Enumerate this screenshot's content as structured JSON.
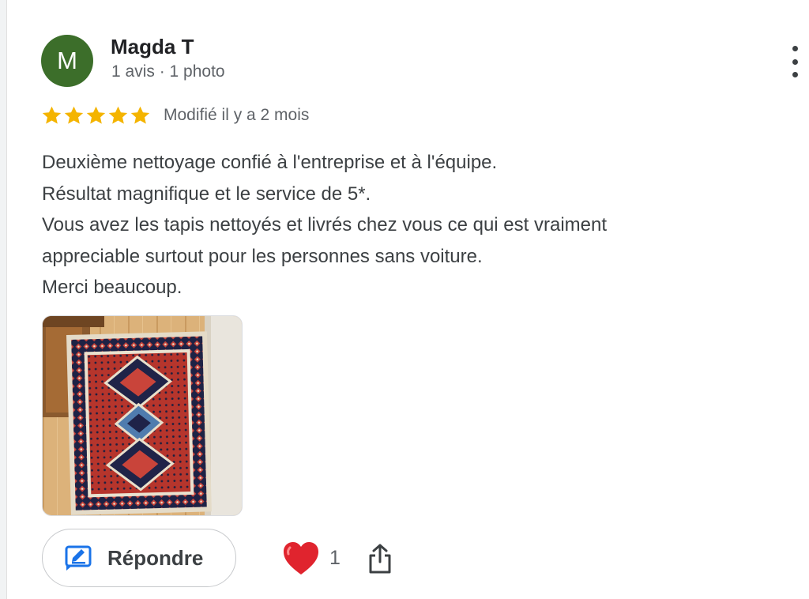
{
  "review": {
    "author": {
      "initial": "M",
      "name": "Magda T",
      "meta": "1 avis · 1 photo",
      "avatar_color": "#3c6e2a"
    },
    "rating": 5,
    "star_color": "#f4b400",
    "date": "Modifié il y a 2 mois",
    "text_lines": [
      "Deuxième nettoyage confié à l'entreprise et à l'équipe.",
      "Résultat magnifique et le service de 5*.",
      "Vous avez les tapis nettoyés et livrés chez vous ce qui est vraiment",
      "appreciable surtout pour les personnes sans voiture.",
      "Merci beaucoup."
    ],
    "photo_icon": "rug-photo",
    "actions": {
      "reply_label": "Répondre",
      "reply_icon": "reply-icon",
      "like_icon": "heart-icon",
      "like_count": "1",
      "share_icon": "share-icon"
    }
  },
  "colors": {
    "accent_blue": "#1a73e8",
    "heart_red": "#e0242e"
  }
}
